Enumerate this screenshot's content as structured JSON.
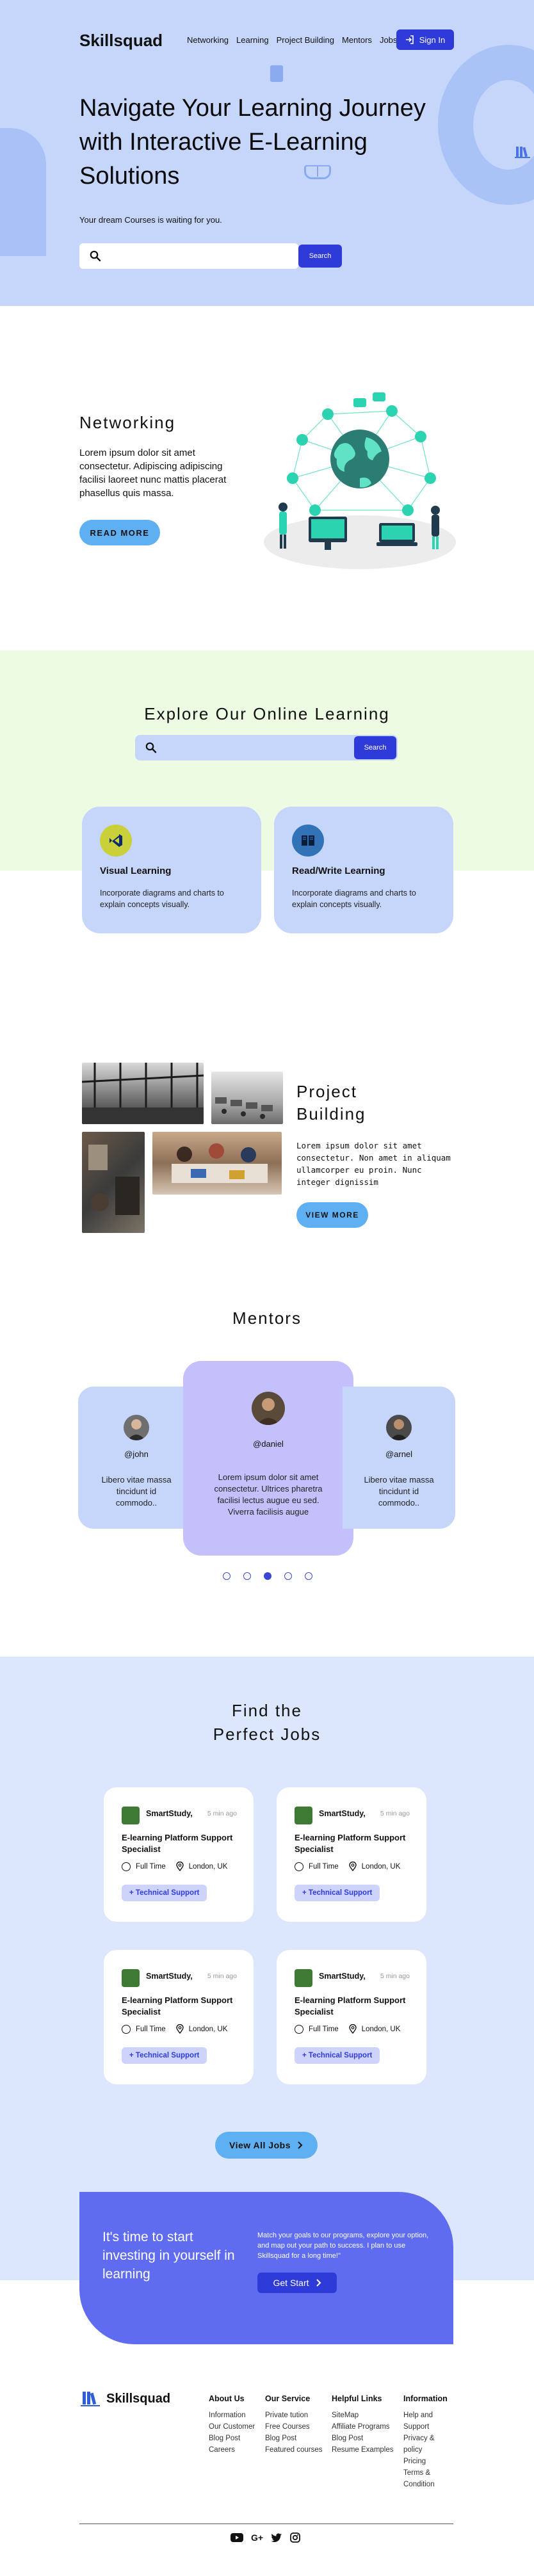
{
  "header": {
    "logo": "Skillsquad",
    "nav": [
      "Networking",
      "Learning",
      "Project Building",
      "Mentors",
      "Jobs"
    ],
    "sign_in": "Sign In"
  },
  "hero": {
    "title": "Navigate Your Learning Journey with Interactive E-Learning Solutions",
    "subtitle": "Your dream Courses is waiting for you.",
    "search_placeholder": "",
    "search_button": "Search"
  },
  "networking": {
    "title": "Networking",
    "text": "Lorem ipsum dolor sit amet consectetur. Adipiscing adipiscing facilisi laoreet nunc mattis placerat phasellus quis massa.",
    "button": "READ MORE"
  },
  "explore": {
    "title": "Explore Our Online Learning",
    "search_placeholder": "",
    "search_button": "Search",
    "cards": [
      {
        "title": "Visual Learning",
        "text": "Incorporate diagrams and charts to explain concepts visually.",
        "icon": "visual-learning-icon"
      },
      {
        "title": "Read/Write Learning",
        "text": "Incorporate diagrams and charts to explain concepts visually.",
        "icon": "book-icon"
      }
    ]
  },
  "project": {
    "title": "Project Building",
    "text": "Lorem ipsum dolor sit amet consectetur. Non amet in aliquam ullamcorper eu proin. Nunc integer dignissim",
    "button": "VIEW MORE"
  },
  "mentors": {
    "title": "Mentors",
    "items": [
      {
        "name": "@john",
        "text": "Libero vitae massa tincidunt id commodo.."
      },
      {
        "name": "@daniel",
        "text": "Lorem ipsum dolor sit amet consectetur. Ultrices pharetra facilisi lectus augue eu sed. Viverra facilisis augue"
      },
      {
        "name": "@arnel",
        "text": "Libero vitae massa tincidunt id commodo.."
      }
    ],
    "active_dot": 3
  },
  "jobs": {
    "title": "Find the Perfect Jobs",
    "items": [
      {
        "company": "SmartStudy,",
        "time": "5 min ago",
        "role": "E-learning Platform Support Specialist",
        "type": "Full Time",
        "location": "London, UK",
        "tag": "+ Technical Support"
      },
      {
        "company": "SmartStudy,",
        "time": "5 min ago",
        "role": "E-learning Platform Support Specialist",
        "type": "Full Time",
        "location": "London, UK",
        "tag": "+ Technical Support"
      },
      {
        "company": "SmartStudy,",
        "time": "5 min ago",
        "role": "E-learning Platform Support Specialist",
        "type": "Full Time",
        "location": "London, UK",
        "tag": "+ Technical Support"
      },
      {
        "company": "SmartStudy,",
        "time": "5 min ago",
        "role": "E-learning Platform Support Specialist",
        "type": "Full Time",
        "location": "London, UK",
        "tag": "+ Technical Support"
      }
    ],
    "view_all": "View All Jobs"
  },
  "cta": {
    "title": "It's time to start investing in yourself in learning",
    "text": "Match your goals to our programs, explore your option, and map out your path to success. I plan to use Skillsquad for a long time!\"",
    "button": "Get Start"
  },
  "footer": {
    "logo": "Skillsquad",
    "columns": [
      {
        "title": "About Us",
        "links": [
          "Information",
          "Our Customer",
          "Blog Post",
          "Careers"
        ]
      },
      {
        "title": "Our Service",
        "links": [
          "Private tution",
          "Free Courses",
          "Blog Post",
          "Featured courses"
        ]
      },
      {
        "title": "Helpful Links",
        "links": [
          "SiteMap",
          "Affiliate Programs",
          "Blog Post",
          "Resume Examples"
        ]
      },
      {
        "title": "Information",
        "links": [
          "Help and Support",
          "Privacy & policy",
          "Pricing",
          "Terms & Condition"
        ]
      }
    ],
    "social": [
      "youtube-icon",
      "google-plus-icon",
      "twitter-icon",
      "instagram-icon"
    ],
    "google_plus_label": "G+"
  },
  "colors": {
    "hero_bg": "#c6d6fb",
    "primary": "#2f3bd9",
    "pill": "#5eb0f3",
    "explore_bg": "#ecfbe2",
    "mentor_active": "#c3c0fb",
    "jobs_bg": "#dce7fd",
    "cta_bg": "#5f6cf0"
  }
}
